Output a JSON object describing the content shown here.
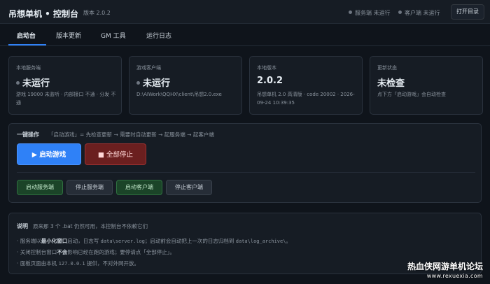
{
  "header": {
    "title": "吊想单机 • 控制台",
    "version": "版本 2.0.2",
    "server_status": "服务端 未运行",
    "client_status": "客户端 未运行",
    "open_dir_label": "打开目录"
  },
  "tabs": [
    "启动台",
    "版本更新",
    "GM 工具",
    "运行日志"
  ],
  "cards": [
    {
      "label": "本地服务端",
      "value": "未运行",
      "desc": "游戏 19000 未监听 · 内部接口 不通 · 分发 不通"
    },
    {
      "label": "游戏客户端",
      "value": "未运行",
      "desc": "D:\\AIWork\\QQHX\\client\\吊想2.0.exe"
    },
    {
      "label": "本地版本",
      "value": "2.0.2",
      "desc": "吊想单机 2.0 高清版 · code 20002 · 2026-09-24 10:39:35"
    },
    {
      "label": "更新状态",
      "value": "未检查",
      "desc": "点下方「启动游戏」会自动检查"
    }
  ],
  "launch": {
    "title": "一键操作",
    "subtitle": "「启动游戏」= 先检查更新 → 需要时自动更新 → 起服务端 → 起客户端",
    "start_label": "▶ 启动游戏",
    "stop_label": "■ 全部停止",
    "start_server": "启动服务端",
    "stop_server": "停止服务端",
    "start_client": "启动客户端",
    "stop_client": "停止客户端"
  },
  "notes": {
    "title": "说明",
    "subtitle": "原来那 3 个 .bat 仍然可用，本控制台不依赖它们",
    "line1_a": "· 服务端以",
    "line1_b": "最小化窗口",
    "line1_c": "启动，日志写",
    "line1_d": "data\\server.log",
    "line1_e": "；启动前会自动把上一次的日志归档到",
    "line1_f": "data\\log_archive\\",
    "line1_g": "。",
    "line2_a": "· 关闭控制台窗口",
    "line2_b": "不会",
    "line2_c": "影响已经在跑的游戏；要停请点「全部停止」。",
    "line3_a": "· 面板页面由本机",
    "line3_b": "127.0.0.1",
    "line3_c": "提供，不对外网开放。"
  },
  "watermark": {
    "line1": "热血侠网游单机论坛",
    "line2": "www.rexuexia.com"
  }
}
